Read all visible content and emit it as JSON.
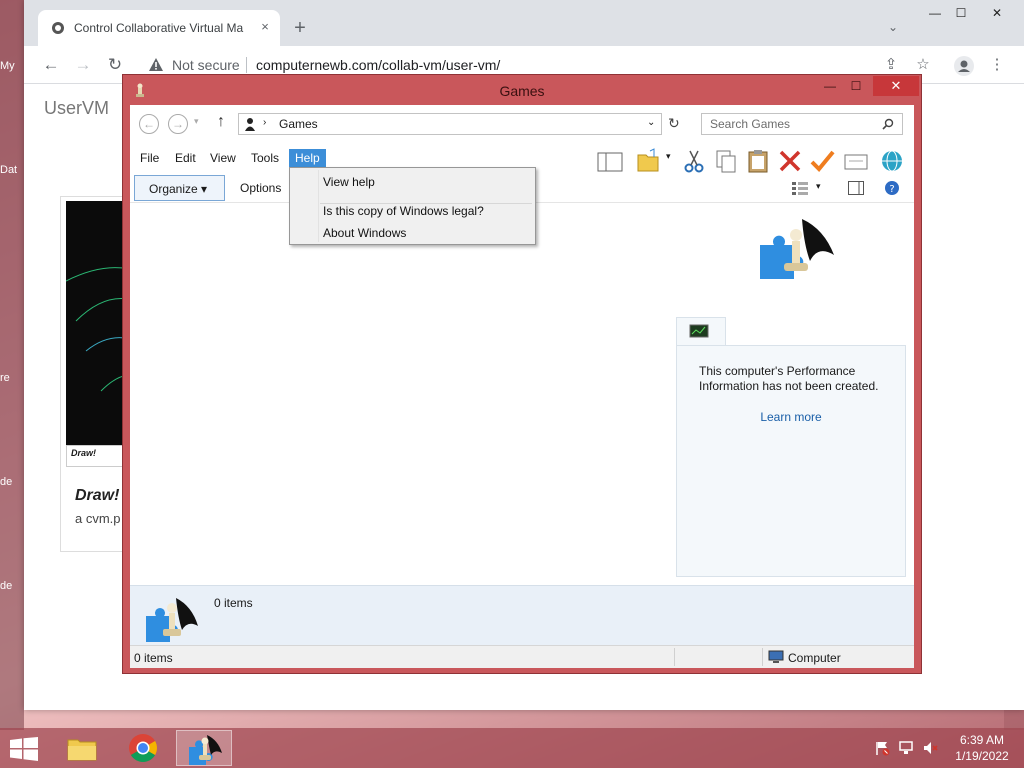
{
  "desktop": {
    "left_labels": [
      "My",
      "Dat",
      "re",
      "de",
      "de"
    ]
  },
  "browser": {
    "tab_title": "Control Collaborative Virtual Ma",
    "tab_close": "×",
    "new_tab": "+",
    "tab_search": "⌄",
    "win_minimize": "—",
    "win_maximize": "☐",
    "win_close": "✕",
    "back": "←",
    "forward": "→",
    "reload": "↻",
    "security_text": "Not secure",
    "url": "computernewb.com/collab-vm/user-vm/",
    "share": "⇪",
    "bookmark": "☆",
    "menu": "⋮"
  },
  "page": {
    "brand": "UserVM",
    "card_caption": "Draw!",
    "card_title": "Draw!",
    "card_sub": "a cvm.p"
  },
  "explorer": {
    "title": "Games",
    "minimize": "—",
    "maximize": "☐",
    "close": "✕",
    "back": "←",
    "forward": "→",
    "up": "↑",
    "address": "Games",
    "search_placeholder": "Search Games",
    "menus": [
      "File",
      "Edit",
      "View",
      "Tools",
      "Help"
    ],
    "organize": "Organize ▾",
    "options": "Options",
    "help_menu": {
      "items": [
        "View help",
        "Is this copy of Windows legal?",
        "About Windows"
      ]
    },
    "perf_text": "This computer's Performance Information has not been created.",
    "learn_more": "Learn more",
    "detail_count": "0 items",
    "status_left": "0 items",
    "status_right": "Computer"
  },
  "taskbar": {
    "clock_time": "6:39 AM",
    "clock_date": "1/19/2022"
  }
}
